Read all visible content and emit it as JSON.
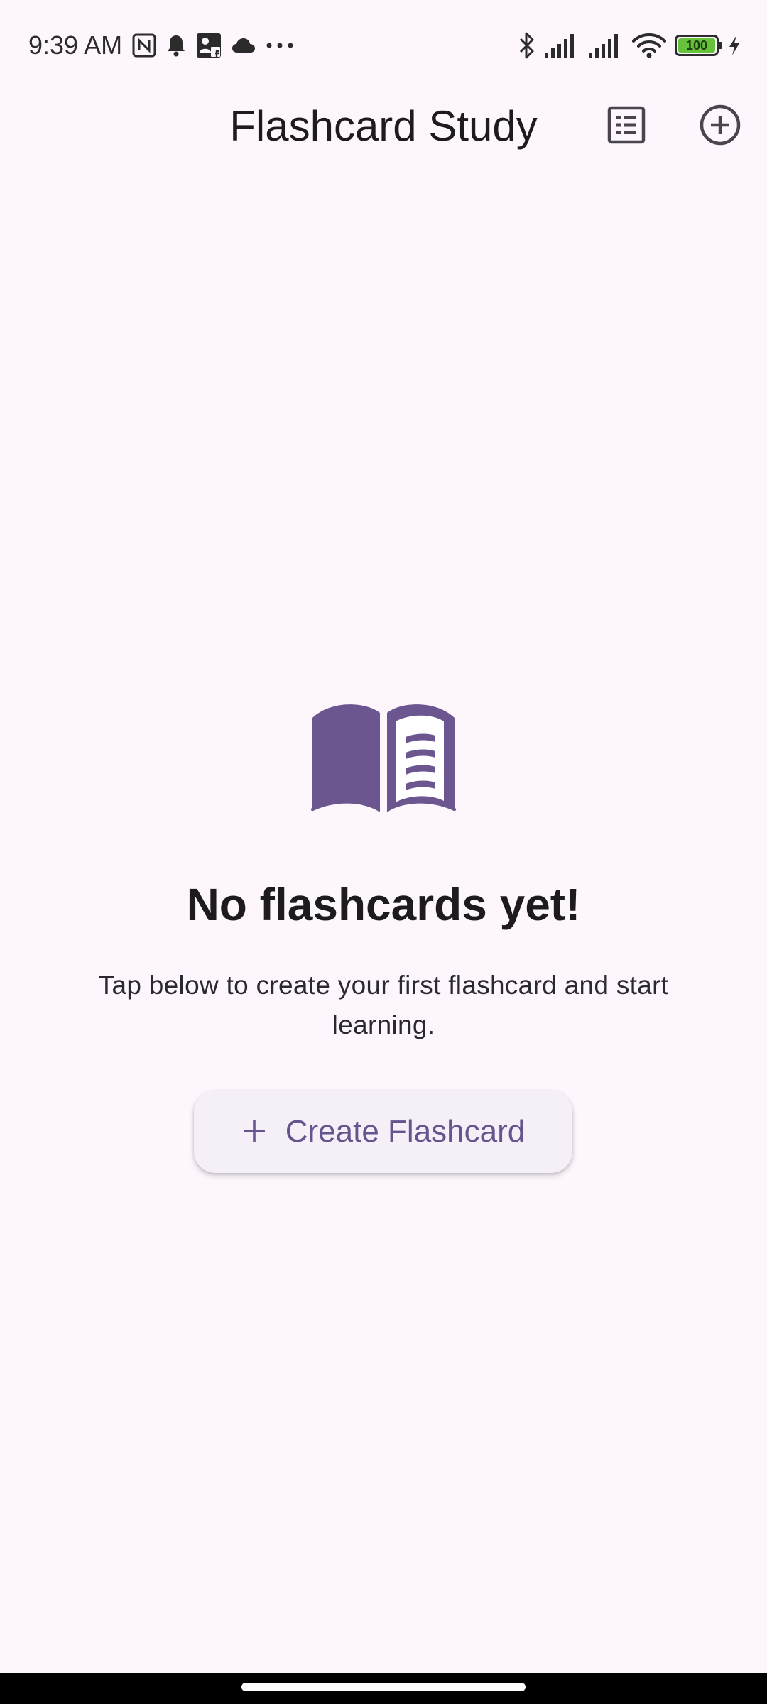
{
  "status_bar": {
    "time": "9:39 AM",
    "left_icons": [
      "nfc-icon",
      "notification-bell-icon",
      "contact-card-icon",
      "cloud-icon",
      "more-dots-icon"
    ],
    "right_icons": [
      "bluetooth-icon",
      "signal-icon",
      "signal-icon",
      "wifi-icon",
      "battery-icon",
      "charging-bolt-icon"
    ],
    "battery_level": "100",
    "battery_fraction": 1.0,
    "battery_color": "#66C23A"
  },
  "app_bar": {
    "title": "Flashcard Study",
    "actions": [
      {
        "icon": "list-view-icon"
      },
      {
        "icon": "add-circle-icon"
      }
    ]
  },
  "empty_state": {
    "icon": "open-book-icon",
    "heading": "No flashcards yet!",
    "subtitle": "Tap below to create your first flashcard and start learning.",
    "button": {
      "icon": "plus-icon",
      "label": "Create Flashcard"
    }
  },
  "theme": {
    "background": "#FDF7FD",
    "primary": "#65558F",
    "icon_fill": "#6B5690",
    "text": "#1D1B20",
    "button_surface": "#F5EFF7"
  }
}
